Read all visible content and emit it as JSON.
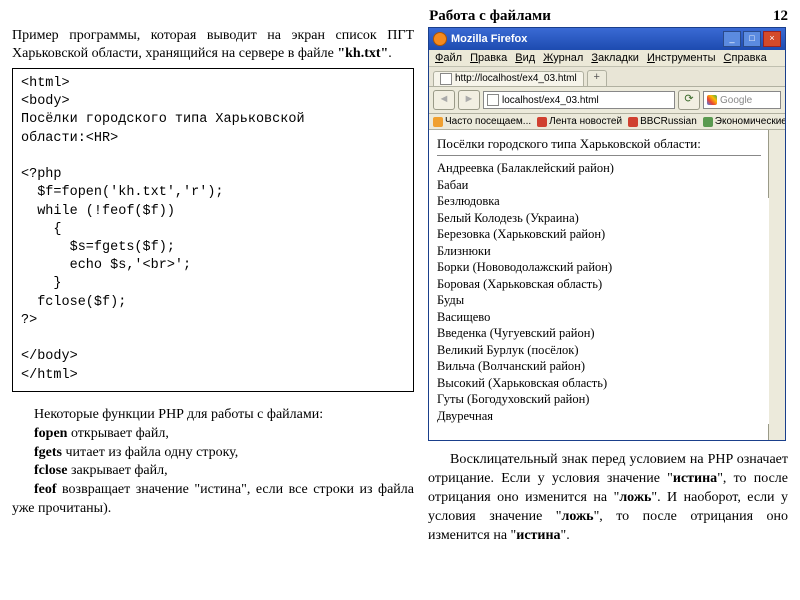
{
  "header": {
    "title": "Работа с файлами",
    "page": "12"
  },
  "intro": {
    "text_pre": "Пример программы, которая выводит на экран список ПГТ Харьковской области, хранящийся на сервере в файле ",
    "file": "\"kh.txt\"",
    "dot": "."
  },
  "code": "<html>\n<body>\nПосёлки городского типа Харьковской\nобласти:<HR>\n\n<?php\n  $f=fopen('kh.txt','r');\n  while (!feof($f))\n    {\n      $s=fgets($f);\n      echo $s,'<br>';\n    }\n  fclose($f);\n?>\n\n</body>\n</html>",
  "funcs": {
    "intro": "Некоторые функции PHP для работы с файлами:",
    "l1a": "fopen",
    "l1b": " открывает файл,",
    "l2a": "fgets",
    "l2b": " читает из файла одну строку,",
    "l3a": "fclose",
    "l3b": " закрывает файл,",
    "l4a": "feof",
    "l4b": " возвращает значение \"истина\", если все строки из файла уже прочитаны)."
  },
  "browser": {
    "title": "Mozilla Firefox",
    "menu": [
      "Файл",
      "Правка",
      "Вид",
      "Журнал",
      "Закладки",
      "Инструменты",
      "Справка"
    ],
    "tab": "http://localhost/ex4_03.html",
    "tab_plus": "+",
    "url": "localhost/ex4_03.html",
    "search_ph": "Google",
    "bookmarks": [
      "Часто посещаем...",
      "Лента новостей",
      "BBCRussian",
      "Экономические изве..."
    ],
    "page_title": "Посёлки городского типа Харьковской области:",
    "lines": [
      "Андреевка (Балаклейский район)",
      "Бабаи",
      "Безлюдовка",
      "Белый Колодезь (Украина)",
      "Березовка (Харьковский район)",
      "Близнюки",
      "Борки (Нововодолажский район)",
      "Боровая (Харьковская область)",
      "Буды",
      "Васищево",
      "Введенка (Чугуевский район)",
      "Великий Бурлук (посёлок)",
      "Вильча (Волчанский район)",
      "Высокий (Харьковская область)",
      "Гуты (Богодуховский район)",
      "Двуречная"
    ]
  },
  "right_para": {
    "s1": "Восклицательный знак перед условием на PHP означает отрицание.",
    "s2a": "Если у условия значение \"",
    "s2b": "истина",
    "s2c": "\", то после отрицания оно изменится на \"",
    "s2d": "ложь",
    "s2e": "\". И наоборот, если у условия значение \"",
    "s2f": "ложь",
    "s2g": "\", то после отрицания оно изменится на \"",
    "s2h": "истина",
    "s2i": "\"."
  }
}
